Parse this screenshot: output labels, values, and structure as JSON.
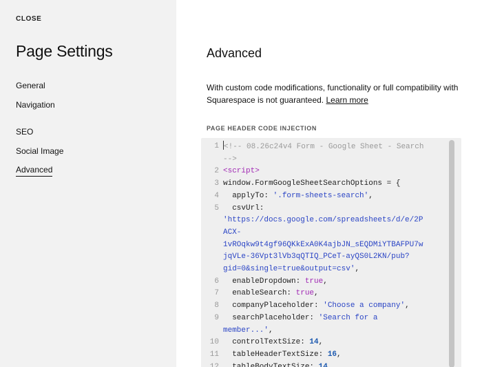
{
  "sidebar": {
    "close_label": "CLOSE",
    "title": "Page Settings",
    "items": [
      {
        "label": "General"
      },
      {
        "label": "Navigation"
      },
      {
        "label": "SEO"
      },
      {
        "label": "Social Image"
      },
      {
        "label": "Advanced",
        "active": true
      }
    ]
  },
  "main": {
    "title": "Advanced",
    "description": "With custom code modifications, functionality or full compatibility with Squarespace is not guaranteed. ",
    "learn_more": "Learn more",
    "field_label": "PAGE HEADER CODE INJECTION"
  },
  "code": {
    "lines": [
      {
        "n": "1",
        "text": "<!-- 08.26c24v4 Form - Google Sheet - Search",
        "cls": "c-comment"
      },
      {
        "n": "",
        "text": "-->",
        "cls": "c-comment"
      },
      {
        "n": "2",
        "text": "<script>",
        "cls": "c-tag"
      },
      {
        "n": "3",
        "text": "window.FormGoogleSheetSearchOptions = {",
        "cls": "c-plain"
      },
      {
        "n": "4",
        "key": "  applyTo: ",
        "val": "'.form-sheets-search'",
        "vcls": "c-string",
        "tail": ","
      },
      {
        "n": "5",
        "key": "  csvUrl:",
        "val": "",
        "vcls": "c-string",
        "tail": ""
      },
      {
        "n": "",
        "text": "'https://docs.google.com/spreadsheets/d/e/2P",
        "cls": "c-string"
      },
      {
        "n": "",
        "text": "ACX-",
        "cls": "c-string"
      },
      {
        "n": "",
        "text": "1vROqkw9t4gf96QKkExA0K4ajbJN_sEQDMiYTBAFPU7w",
        "cls": "c-string"
      },
      {
        "n": "",
        "text": "jqVLe-36Vpt3lVb3qQTIQ_PCeT-ayQS0L2KN/pub?",
        "cls": "c-string"
      },
      {
        "n": "",
        "text": "gid=0&single=true&output=csv'",
        "cls": "c-string",
        "tail": ","
      },
      {
        "n": "6",
        "key": "  enableDropdown: ",
        "val": "true",
        "vcls": "c-kw",
        "tail": ","
      },
      {
        "n": "7",
        "key": "  enableSearch: ",
        "val": "true",
        "vcls": "c-kw",
        "tail": ","
      },
      {
        "n": "8",
        "key": "  companyPlaceholder: ",
        "val": "'Choose a company'",
        "vcls": "c-string",
        "tail": ","
      },
      {
        "n": "9",
        "key": "  searchPlaceholder: ",
        "val": "'Search for a",
        "vcls": "c-string",
        "tail": ""
      },
      {
        "n": "",
        "text": "member...'",
        "cls": "c-string",
        "tail": ","
      },
      {
        "n": "10",
        "key": "  controlTextSize: ",
        "val": "14",
        "vcls": "c-num",
        "tail": ","
      },
      {
        "n": "11",
        "key": "  tableHeaderTextSize: ",
        "val": "16",
        "vcls": "c-num",
        "tail": ","
      },
      {
        "n": "12",
        "key": "  tableBodyTextSize: ",
        "val": "14",
        "vcls": "c-num",
        "tail": ","
      }
    ]
  }
}
